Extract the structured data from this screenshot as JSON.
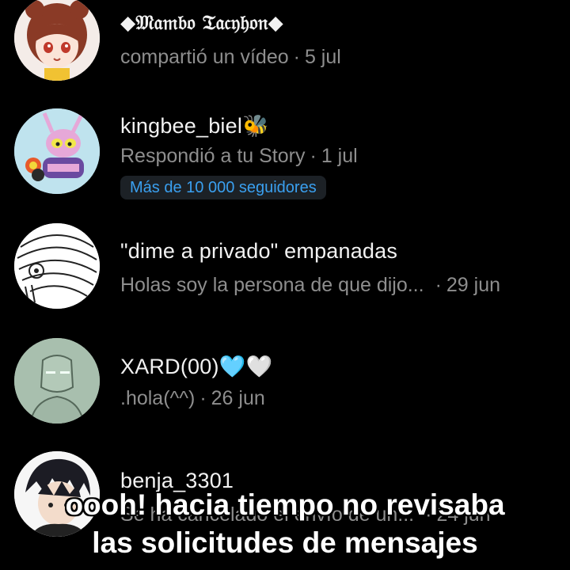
{
  "requests": [
    {
      "name": "◆𝔐𝔞𝔪𝔟𝔬 𝔗𝔞𝔠𝔶𝔥𝔬𝔫◆",
      "activity": "compartió un vídeo",
      "separator": "·",
      "date": "5 jul",
      "avatar_icon": "anime-girl-avatar-icon"
    },
    {
      "name": "kingbee_biel🐝",
      "activity": "Respondió a tu Story",
      "separator": "·",
      "date": "1 jul",
      "badge": "Más de 10 000 seguidores",
      "avatar_icon": "bug-character-avatar-icon"
    },
    {
      "name": "\"dime a privado\" empanadas",
      "activity": "Holas soy la persona de que dijo...",
      "separator": "·",
      "date": "29 jun",
      "avatar_icon": "sketch-face-avatar-icon"
    },
    {
      "name": "XARD(00)🩵🤍",
      "activity": ".hola(^^)",
      "separator": "·",
      "date": "26 jun",
      "avatar_icon": "robot-sketch-avatar-icon"
    },
    {
      "name": "benja_3301",
      "activity": "Se ha cancelado el envío de un...",
      "separator": "·",
      "date": "24 jun",
      "avatar_icon": "anime-boy-avatar-icon"
    }
  ],
  "caption": {
    "line1": "oooh! hacia tiempo no revisaba",
    "line2": "las solicitudes de mensajes"
  },
  "colors": {
    "background": "#000000",
    "primary_text": "#f2f2f2",
    "secondary_text": "#8e8e8e",
    "badge_text": "#3aa0f0",
    "badge_bg": "#1c2126"
  }
}
